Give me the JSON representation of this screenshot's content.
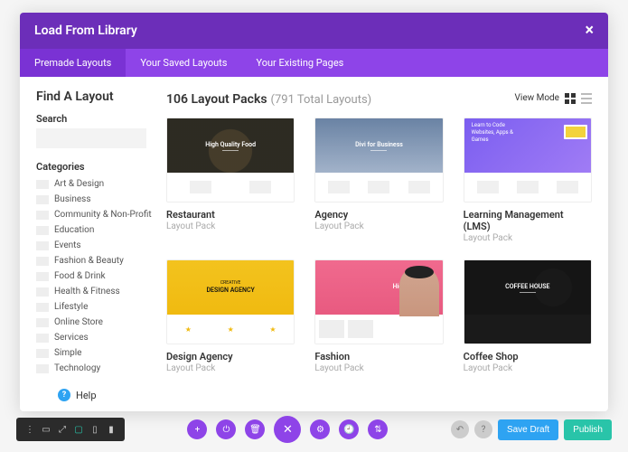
{
  "modal": {
    "title": "Load From Library",
    "tabs": [
      {
        "label": "Premade Layouts",
        "active": true
      },
      {
        "label": "Your Saved Layouts",
        "active": false
      },
      {
        "label": "Your Existing Pages",
        "active": false
      }
    ]
  },
  "sidebar": {
    "heading": "Find A Layout",
    "search_label": "Search",
    "search_value": "",
    "categories_label": "Categories",
    "categories": [
      "Art & Design",
      "Business",
      "Community & Non-Profit",
      "Education",
      "Events",
      "Fashion & Beauty",
      "Food & Drink",
      "Health & Fitness",
      "Lifestyle",
      "Online Store",
      "Services",
      "Simple",
      "Technology"
    ],
    "help_label": "Help"
  },
  "content": {
    "count": "106 Layout Packs",
    "total": "(791 Total Layouts)",
    "view_mode_label": "View Mode",
    "cards": [
      {
        "title": "Restaurant",
        "subtitle": "Layout Pack",
        "hero": "High Quality Food",
        "klass": "t-restaurant"
      },
      {
        "title": "Agency",
        "subtitle": "Layout Pack",
        "hero": "Divi for Business",
        "klass": "t-agency"
      },
      {
        "title": "Learning Management (LMS)",
        "subtitle": "Layout Pack",
        "hero": "Learn to Code Websites, Apps & Games",
        "klass": "t-lms"
      },
      {
        "title": "Design Agency",
        "subtitle": "Layout Pack",
        "hero": "DESIGN AGENCY",
        "klass": "t-design"
      },
      {
        "title": "Fashion",
        "subtitle": "Layout Pack",
        "hero": "High Fashion",
        "klass": "t-fashion"
      },
      {
        "title": "Coffee Shop",
        "subtitle": "Layout Pack",
        "hero": "COFFEE HOUSE",
        "klass": "t-coffee"
      }
    ]
  },
  "bottom": {
    "save_draft": "Save Draft",
    "publish": "Publish"
  }
}
